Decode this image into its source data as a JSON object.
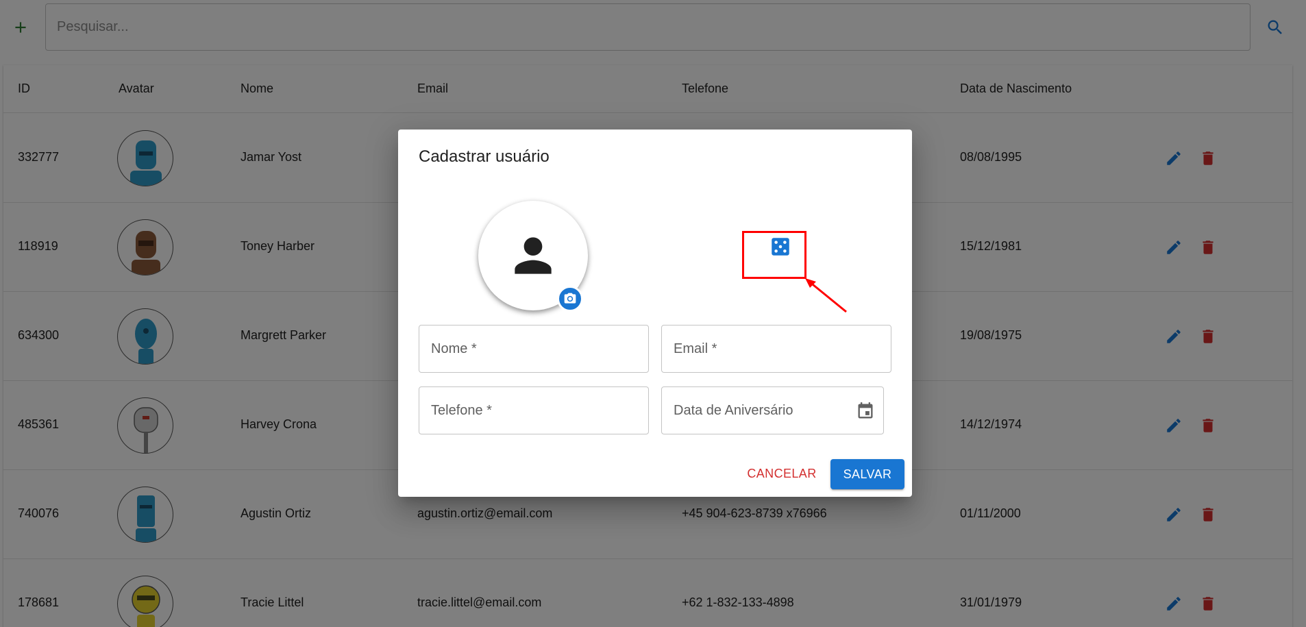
{
  "search": {
    "placeholder": "Pesquisar..."
  },
  "table": {
    "headers": [
      "ID",
      "Avatar",
      "Nome",
      "Email",
      "Telefone",
      "Data de Nascimento"
    ],
    "rows": [
      {
        "id": "332777",
        "nome": "Jamar Yost",
        "email": "",
        "telefone": "",
        "nascimento": "08/08/1995",
        "avatar_color": "#2e9bc9"
      },
      {
        "id": "118919",
        "nome": "Toney Harber",
        "email": "",
        "telefone": "",
        "nascimento": "15/12/1981",
        "avatar_color": "#8d5a3b"
      },
      {
        "id": "634300",
        "nome": "Margrett Parker",
        "email": "",
        "telefone": "",
        "nascimento": "19/08/1975",
        "avatar_color": "#2e9bc9"
      },
      {
        "id": "485361",
        "nome": "Harvey Crona",
        "email": "",
        "telefone": "",
        "nascimento": "14/12/1974",
        "avatar_color": "#c8c8c8"
      },
      {
        "id": "740076",
        "nome": "Agustin Ortiz",
        "email": "agustin.ortiz@email.com",
        "telefone": "+45 904-623-8739 x76966",
        "nascimento": "01/11/2000",
        "avatar_color": "#2e9bc9"
      },
      {
        "id": "178681",
        "nome": "Tracie Littel",
        "email": "tracie.littel@email.com",
        "telefone": "+62 1-832-133-4898",
        "nascimento": "31/01/1979",
        "avatar_color": "#e6d22e"
      }
    ]
  },
  "dialog": {
    "title": "Cadastrar usuário",
    "fields": {
      "nome": "Nome *",
      "email": "Email *",
      "telefone": "Telefone *",
      "aniversario": "Data de Aniversário"
    },
    "cancel_label": "CANCELAR",
    "save_label": "SALVAR"
  },
  "colors": {
    "primary": "#1976d2",
    "danger": "#d32f2f",
    "add": "#2e7d32",
    "highlight": "#ff0000"
  },
  "icons": [
    "add-icon",
    "search-icon",
    "edit-icon",
    "delete-icon",
    "person-icon",
    "camera-icon",
    "dice-icon",
    "calendar-icon"
  ]
}
